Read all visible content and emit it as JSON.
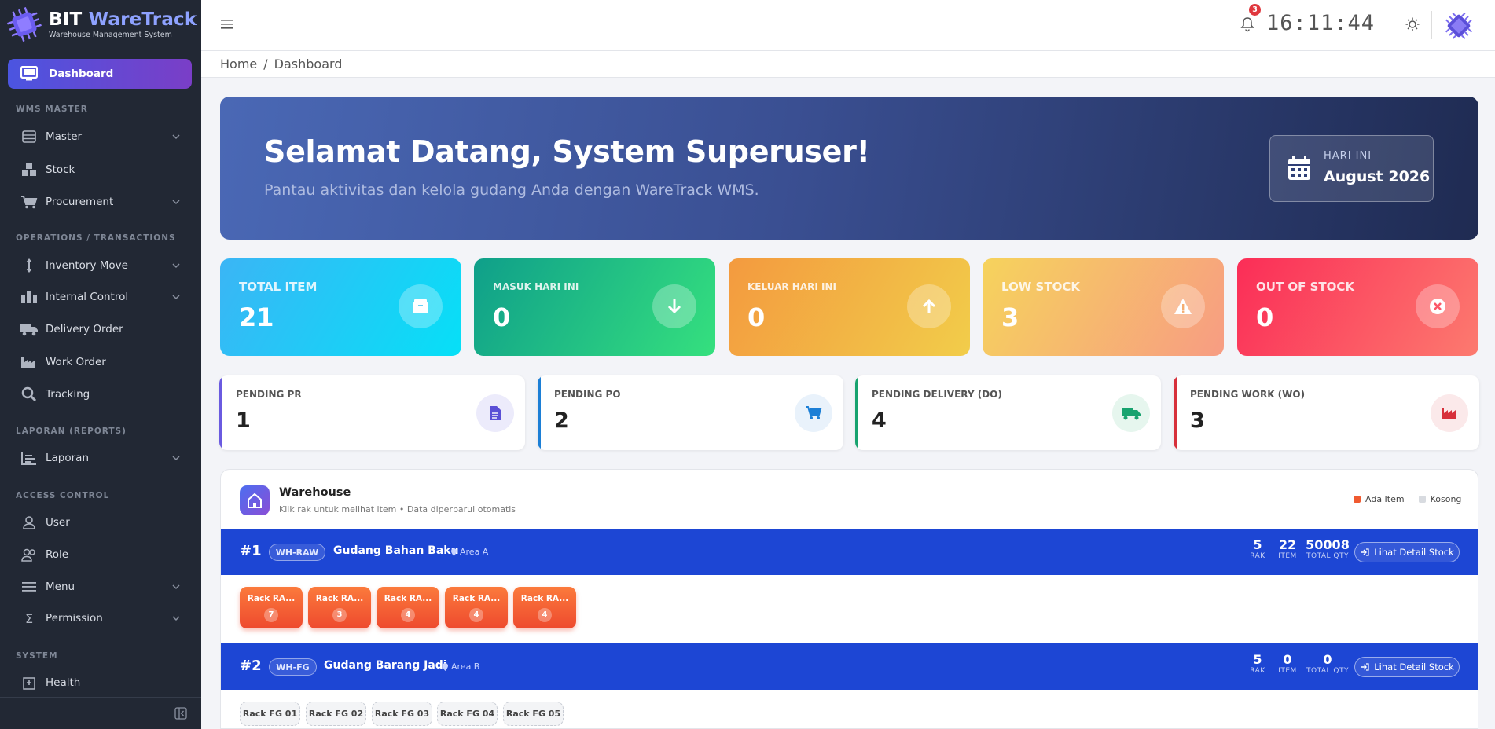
{
  "brand": {
    "bit": "BIT",
    "name": "WareTrack",
    "tagline": "Warehouse Management System"
  },
  "sidebar": {
    "active": "Dashboard",
    "sections": {
      "wms": "WMS MASTER",
      "ops": "OPERATIONS / TRANSACTIONS",
      "reports": "LAPORAN (REPORTS)",
      "access": "ACCESS CONTROL",
      "system": "SYSTEM"
    },
    "items": {
      "master": "Master",
      "stock": "Stock",
      "procurement": "Procurement",
      "inventory_move": "Inventory Move",
      "internal_control": "Internal Control",
      "delivery_order": "Delivery Order",
      "work_order": "Work Order",
      "tracking": "Tracking",
      "laporan": "Laporan",
      "user": "User",
      "role": "Role",
      "menu": "Menu",
      "permission": "Permission",
      "health": "Health"
    }
  },
  "topbar": {
    "notif_count": "3",
    "clock": "16:11:44"
  },
  "breadcrumb": {
    "home": "Home",
    "sep": "/",
    "current": "Dashboard"
  },
  "hero": {
    "title": "Selamat Datang, System Superuser!",
    "subtitle": "Pantau aktivitas dan kelola gudang Anda dengan WareTrack WMS.",
    "date_label": "HARI INI",
    "date_value": "August 2026"
  },
  "stats": [
    {
      "label": "TOTAL ITEM",
      "value": "21"
    },
    {
      "label": "MASUK HARI INI",
      "value": "0"
    },
    {
      "label": "KELUAR HARI INI",
      "value": "0"
    },
    {
      "label": "LOW STOCK",
      "value": "3"
    },
    {
      "label": "OUT OF STOCK",
      "value": "0"
    }
  ],
  "pending": [
    {
      "label": "PENDING PR",
      "value": "1"
    },
    {
      "label": "PENDING PO",
      "value": "2"
    },
    {
      "label": "PENDING DELIVERY (DO)",
      "value": "4"
    },
    {
      "label": "PENDING WORK (WO)",
      "value": "3"
    }
  ],
  "warehouse": {
    "title": "Warehouse",
    "subtitle": "Klik rak untuk melihat item • Data diperbarui otomatis",
    "legend_filled": "Ada Item",
    "legend_empty": "Kosong",
    "rows": [
      {
        "idx": "#1",
        "code": "WH-RAW",
        "name": "Gudang Bahan Baku",
        "area": "Area A",
        "rak": "5",
        "item": "22",
        "qty": "50008",
        "rak_label": "RAK",
        "item_label": "ITEM",
        "qty_label": "TOTAL QTY",
        "detail": "Lihat Detail Stock",
        "racks": [
          {
            "name": "Rack RA...",
            "count": "7"
          },
          {
            "name": "Rack RA...",
            "count": "3"
          },
          {
            "name": "Rack RA...",
            "count": "4"
          },
          {
            "name": "Rack RA...",
            "count": "4"
          },
          {
            "name": "Rack RA...",
            "count": "4"
          }
        ]
      },
      {
        "idx": "#2",
        "code": "WH-FG",
        "name": "Gudang Barang Jadi",
        "area": "Area B",
        "rak": "5",
        "item": "0",
        "qty": "0",
        "rak_label": "RAK",
        "item_label": "ITEM",
        "qty_label": "TOTAL QTY",
        "detail": "Lihat Detail Stock",
        "racks": [
          {
            "name": "Rack FG 01"
          },
          {
            "name": "Rack FG 02"
          },
          {
            "name": "Rack FG 03"
          },
          {
            "name": "Rack FG 04"
          },
          {
            "name": "Rack FG 05"
          }
        ]
      }
    ]
  },
  "colors": {
    "sidebar": "#222834",
    "accent": "#5b4fd9",
    "warehouse_row": "#1d46d4",
    "rack": "#f25a32"
  }
}
